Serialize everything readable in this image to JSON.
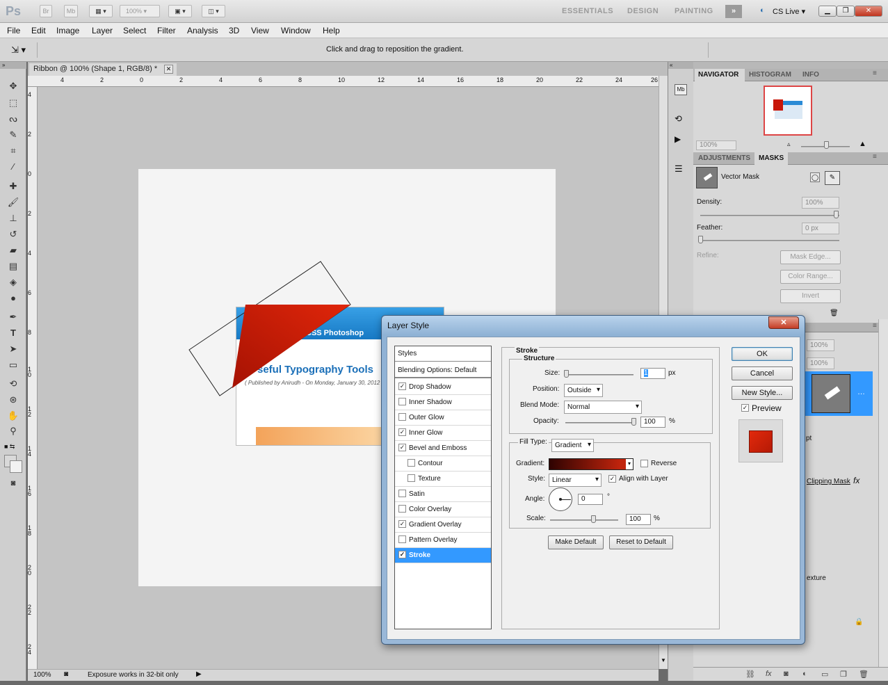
{
  "app": {
    "logo": "Ps",
    "bridge": "Br",
    "minibridge": "Mb",
    "zoom": "100%",
    "workspaces": [
      "ESSENTIALS",
      "DESIGN",
      "PAINTING"
    ],
    "cslive": "CS Live"
  },
  "menu": [
    "File",
    "Edit",
    "Image",
    "Layer",
    "Select",
    "Filter",
    "Analysis",
    "3D",
    "View",
    "Window",
    "Help"
  ],
  "options": {
    "hint": "Click and drag to reposition the gradient."
  },
  "document": {
    "tab_title": "Ribbon @ 100% (Shape 1, RGB/8) *",
    "ruler_h": [
      "4",
      "2",
      "0",
      "2",
      "4",
      "6",
      "8",
      "10",
      "12",
      "14",
      "16",
      "18",
      "20",
      "22",
      "24",
      "26"
    ],
    "ruler_v": [
      "4",
      "2",
      "0",
      "2",
      "4",
      "6",
      "8",
      "1 0",
      "1 2",
      "1 4",
      "1 6",
      "1 8",
      "2 0",
      "2 2",
      "2 4"
    ],
    "card_header": "CSS  Photoshop",
    "card_title": "seful Typography Tools",
    "card_byline": "( Published by Anirudh - On Monday, January 30, 2012"
  },
  "status": {
    "zoom": "100%",
    "info": "Exposure works in 32-bit only"
  },
  "navigator": {
    "tabs": [
      "NAVIGATOR",
      "HISTOGRAM",
      "INFO"
    ],
    "zoom": "100%"
  },
  "masks": {
    "tabs": [
      "ADJUSTMENTS",
      "MASKS"
    ],
    "title": "Vector Mask",
    "density_label": "Density:",
    "density": "100%",
    "feather_label": "Feather:",
    "feather": "0 px",
    "refine_label": "Refine:",
    "buttons": [
      "Mask Edge...",
      "Color Range...",
      "Invert"
    ]
  },
  "layers": {
    "opacity": "100%",
    "fill": "100%",
    "row_text_1": "pt",
    "clipping": "Clipping Mask",
    "row_text_2": "exture"
  },
  "dialog": {
    "title": "Layer Style",
    "styles_header": "Styles",
    "blending": "Blending Options: Default",
    "items": [
      {
        "label": "Drop Shadow",
        "checked": true
      },
      {
        "label": "Inner Shadow",
        "checked": false
      },
      {
        "label": "Outer Glow",
        "checked": false
      },
      {
        "label": "Inner Glow",
        "checked": true
      },
      {
        "label": "Bevel and Emboss",
        "checked": true
      },
      {
        "label": "Contour",
        "checked": false
      },
      {
        "label": "Texture",
        "checked": false
      },
      {
        "label": "Satin",
        "checked": false
      },
      {
        "label": "Color Overlay",
        "checked": false
      },
      {
        "label": "Gradient Overlay",
        "checked": true
      },
      {
        "label": "Pattern Overlay",
        "checked": false
      },
      {
        "label": "Stroke",
        "checked": true
      }
    ],
    "stroke": {
      "group": "Stroke",
      "structure": "Structure",
      "size_label": "Size:",
      "size": "1",
      "size_unit": "px",
      "position_label": "Position:",
      "position": "Outside",
      "blend_label": "Blend Mode:",
      "blend": "Normal",
      "opacity_label": "Opacity:",
      "opacity": "100",
      "opacity_unit": "%",
      "filltype_label": "Fill Type:",
      "filltype": "Gradient",
      "gradient_label": "Gradient:",
      "reverse": "Reverse",
      "style_label": "Style:",
      "style": "Linear",
      "align": "Align with Layer",
      "angle_label": "Angle:",
      "angle": "0",
      "angle_unit": "°",
      "scale_label": "Scale:",
      "scale": "100",
      "scale_unit": "%",
      "make_default": "Make Default",
      "reset_default": "Reset to Default"
    },
    "buttons": {
      "ok": "OK",
      "cancel": "Cancel",
      "new_style": "New Style...",
      "preview": "Preview"
    }
  },
  "colors": {
    "ribbon": "#cc1a06",
    "selection": "#3399ff"
  }
}
